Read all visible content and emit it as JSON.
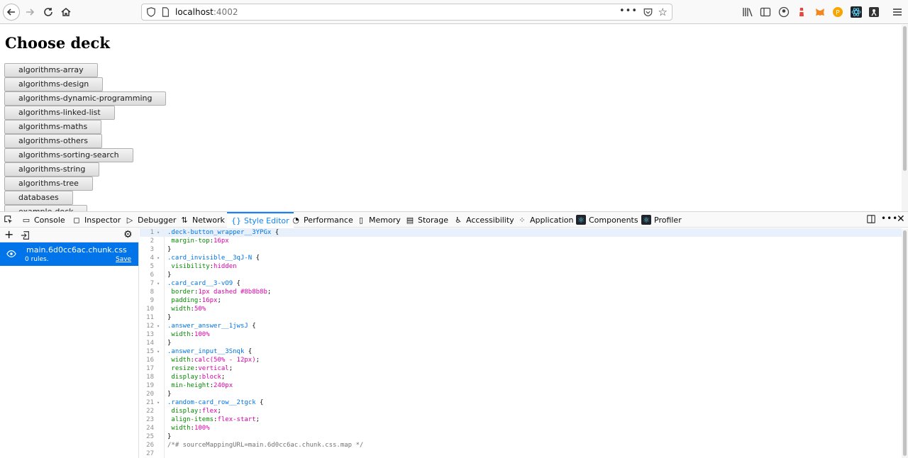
{
  "browser": {
    "url_host": "localhost",
    "url_port": ":4002",
    "more_label": "•••",
    "star_label": "☆"
  },
  "page": {
    "title": "Choose deck",
    "decks": [
      "algorithms-array",
      "algorithms-design",
      "algorithms-dynamic-programming",
      "algorithms-linked-list",
      "algorithms-maths",
      "algorithms-others",
      "algorithms-sorting-search",
      "algorithms-string",
      "algorithms-tree",
      "databases",
      "example-deck"
    ]
  },
  "devtools": {
    "tabs": [
      {
        "label": "Console",
        "icon": "console-icon"
      },
      {
        "label": "Inspector",
        "icon": "inspector-icon"
      },
      {
        "label": "Debugger",
        "icon": "debugger-icon"
      },
      {
        "label": "Network",
        "icon": "network-icon"
      },
      {
        "label": "Style Editor",
        "icon": "style-editor-icon"
      },
      {
        "label": "Performance",
        "icon": "performance-icon"
      },
      {
        "label": "Memory",
        "icon": "memory-icon"
      },
      {
        "label": "Storage",
        "icon": "storage-icon"
      },
      {
        "label": "Accessibility",
        "icon": "accessibility-icon"
      },
      {
        "label": "Application",
        "icon": "application-icon"
      },
      {
        "label": "Components",
        "icon": "react-components-icon"
      },
      {
        "label": "Profiler",
        "icon": "react-profiler-icon"
      }
    ],
    "active_tab": "Style Editor",
    "more_label": "•••",
    "close_label": "✕",
    "sidebar": {
      "new_label": "+",
      "gear_label": "⚙",
      "sheet": {
        "name": "main.6d0cc6ac.chunk.css",
        "rules": "0 rules.",
        "save": "Save"
      }
    },
    "code_lines": [
      ".deck-button_wrapper__3YPGx {",
      " margin-top:16px",
      "}",
      ".card_invisible__3qJ-N {",
      " visibility:hidden",
      "}",
      ".card_card__3-vO9 {",
      " border:1px dashed #8b8b8b;",
      " padding:16px;",
      " width:50%",
      "}",
      ".answer_answer__1jwsJ {",
      " width:100%",
      "}",
      ".answer_input__3Snqk {",
      " width:calc(50% - 12px);",
      " resize:vertical;",
      " display:block;",
      " min-height:240px",
      "}",
      ".random-card_row__2tgck {",
      " display:flex;",
      " align-items:flex-start;",
      " width:100%",
      "}",
      "/*# sourceMappingURL=main.6d0cc6ac.chunk.css.map */",
      ""
    ],
    "fold_marker": "▾"
  },
  "colors": {
    "accent": "#0a84ff",
    "selected_sheet": "#0074e8",
    "selector": "#0074e8",
    "property": "#058b00",
    "value": "#dd00a9"
  }
}
